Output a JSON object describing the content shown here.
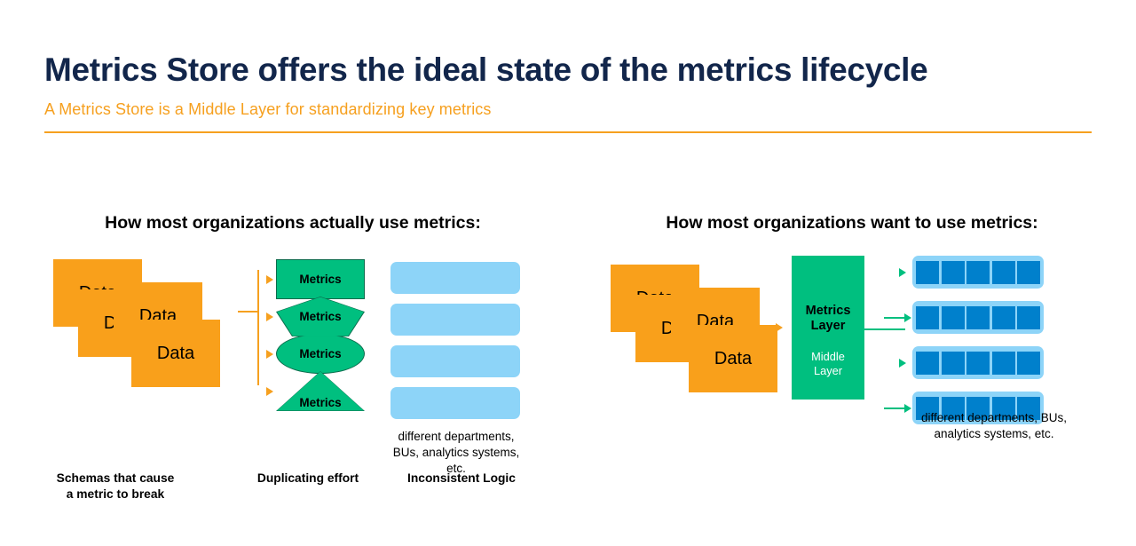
{
  "header": {
    "title": "Metrics Store offers the ideal state of the metrics lifecycle",
    "subtitle": "A Metrics Store is a Middle Layer for standardizing key metrics",
    "accent_color": "#f6a01f",
    "title_color": "#12264b"
  },
  "colors": {
    "orange": "#f9a01b",
    "green": "#00bf7f",
    "light_blue": "#8dd4f8",
    "dark_blue": "#0080cc",
    "navy": "#12264b"
  },
  "left_panel": {
    "heading": "How most organizations actually use metrics:",
    "data_boxes": [
      {
        "label": "Data"
      },
      {
        "label": "Data"
      },
      {
        "label": "Data"
      },
      {
        "label": "Data"
      }
    ],
    "metrics_shapes": [
      {
        "label": "Metrics",
        "shape": "rectangle"
      },
      {
        "label": "Metrics",
        "shape": "pentagon"
      },
      {
        "label": "Metrics",
        "shape": "ellipse"
      },
      {
        "label": "Metrics",
        "shape": "triangle"
      }
    ],
    "light_bars_count": 4,
    "consumers_caption": "different departments,\nBUs, analytics\nsystems, etc.",
    "bottom_labels": [
      "Schemas that cause\na metric to break",
      "Duplicating effort",
      "Inconsistent Logic"
    ]
  },
  "right_panel": {
    "heading": "How most organizations want to use metrics:",
    "data_boxes": [
      {
        "label": "Data"
      },
      {
        "label": "Data"
      },
      {
        "label": "Data"
      },
      {
        "label": "Data"
      }
    ],
    "metrics_layer": {
      "title": "Metrics\nLayer",
      "subtitle": "Middle\nLayer"
    },
    "segmented_bars": [
      {
        "segments": 5,
        "connector": "short"
      },
      {
        "segments": 5,
        "connector": "long"
      },
      {
        "segments": 5,
        "connector": "short"
      },
      {
        "segments": 5,
        "connector": "long"
      }
    ],
    "consumers_caption": "different departments,\nBUs, analytics\nsystems, etc."
  }
}
